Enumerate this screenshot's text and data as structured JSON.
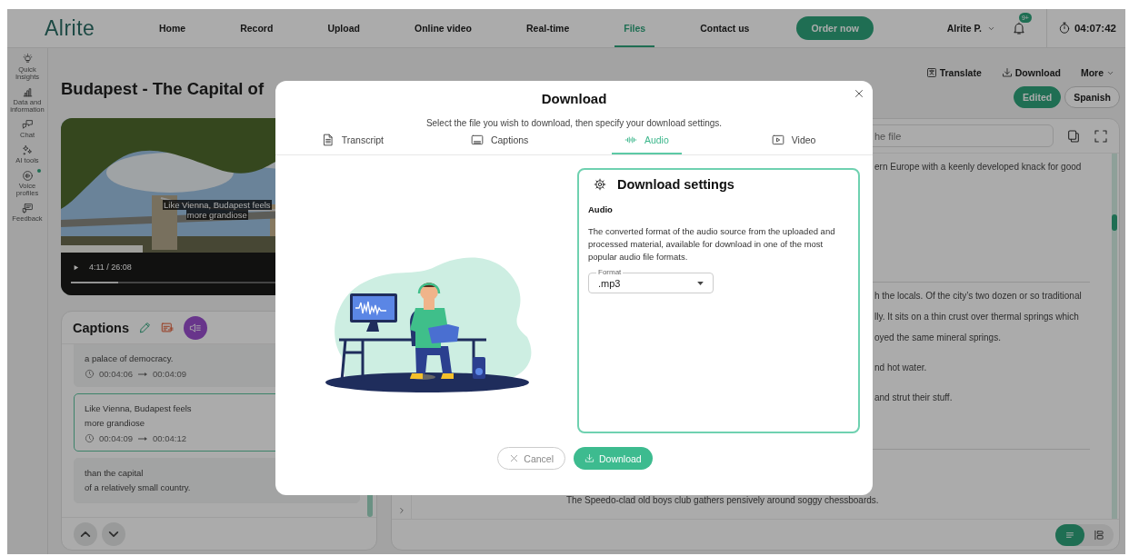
{
  "app": {
    "logo": "Alrite"
  },
  "nav": [
    {
      "label": "Home",
      "selected": false
    },
    {
      "label": "Record",
      "selected": false
    },
    {
      "label": "Upload",
      "selected": false
    },
    {
      "label": "Online video",
      "selected": false
    },
    {
      "label": "Real-time",
      "selected": false
    },
    {
      "label": "Files",
      "selected": true
    },
    {
      "label": "Contact us",
      "selected": false
    }
  ],
  "order_button": "Order now",
  "user": {
    "name": "Alrite P.",
    "notifications": "9+"
  },
  "timer": "04:07:42",
  "sidebar": {
    "items": [
      {
        "label": "Quick Insights",
        "kind": "insights",
        "indicator": false
      },
      {
        "label": "Data and information",
        "kind": "data",
        "indicator": false
      },
      {
        "label": "Chat",
        "kind": "chat",
        "indicator": false
      },
      {
        "label": "AI tools",
        "kind": "ai",
        "indicator": false
      },
      {
        "label": "Voice profiles",
        "kind": "voice",
        "indicator": true
      },
      {
        "label": "Feedback",
        "kind": "feedback",
        "indicator": false
      }
    ]
  },
  "document": {
    "title": "Budapest - The Capital of",
    "actions": [
      {
        "label": "Translate",
        "kind": "translate"
      },
      {
        "label": "Download",
        "kind": "download"
      },
      {
        "label": "More",
        "kind": "more"
      }
    ],
    "versions": [
      {
        "label": "Edited",
        "selected": true
      },
      {
        "label": "Spanish",
        "selected": false
      }
    ]
  },
  "video": {
    "subtitle": [
      "Like Vienna, Budapest feels",
      "more grandiose"
    ],
    "time": "4:11 / 26:08",
    "level": 0.16
  },
  "captions": {
    "title": "Captions",
    "items": [
      {
        "lines": [
          "a palace of democracy."
        ],
        "start": "00:04:06",
        "end": "00:04:09",
        "selected": false
      },
      {
        "lines": [
          "Like Vienna, Budapest feels",
          "more grandiose"
        ],
        "start": "00:04:09",
        "end": "00:04:12",
        "selected": true
      },
      {
        "lines": [
          "than the capital",
          "of a relatively small country."
        ],
        "selected": false
      }
    ]
  },
  "transcript": {
    "search_placeholder": "he file",
    "sections": [
      {
        "paragraphs": [
          [
            "ern Europe with a keenly developed knack for good"
          ]
        ]
      },
      {
        "paragraphs": [
          [
            "h the locals. Of the city’s two dozen or so traditional",
            "lly. It sits on a thin crust over thermal springs which",
            "oyed the same mineral springs."
          ],
          [
            "nd hot water."
          ],
          [
            "and strut their stuff."
          ]
        ]
      },
      {
        "paragraphs": [
          [
            "The Speedo-clad old boys club gathers pensively around soggy chessboards."
          ]
        ]
      }
    ]
  },
  "view_toggle": [
    {
      "kind": "text",
      "selected": true
    },
    {
      "kind": "blocks",
      "selected": false
    }
  ],
  "modal": {
    "title": "Download",
    "subtitle": "Select the file you wish to download, then specify your download settings.",
    "tabs": [
      {
        "label": "Transcript",
        "kind": "transcript",
        "selected": false
      },
      {
        "label": "Captions",
        "kind": "captions",
        "selected": false
      },
      {
        "label": "Audio",
        "kind": "audio",
        "selected": true
      },
      {
        "label": "Video",
        "kind": "video",
        "selected": false
      }
    ],
    "settings": {
      "title": "Download settings",
      "heading": "Audio",
      "description": "The converted format of the audio source from the uploaded and processed material, available for download in one of the most popular audio file formats.",
      "format": {
        "label": "Format",
        "value": ".mp3"
      }
    },
    "buttons": [
      {
        "label": "Cancel",
        "kind": "cancel"
      },
      {
        "label": "Download",
        "kind": "primary"
      }
    ]
  }
}
